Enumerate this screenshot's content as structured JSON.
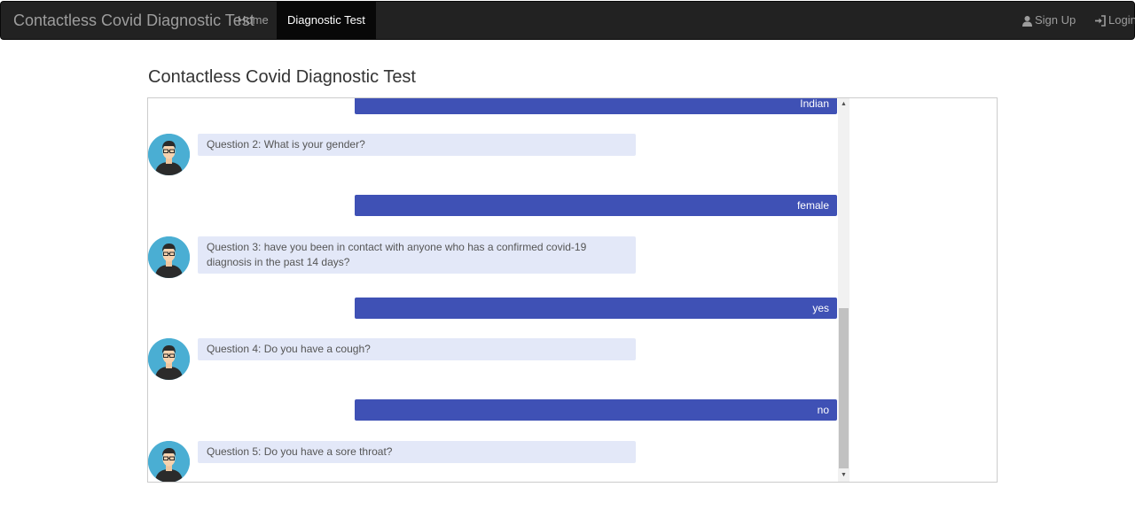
{
  "navbar": {
    "brand": "Contactless Covid Diagnostic Test",
    "links": [
      {
        "label": "Home",
        "active": false
      },
      {
        "label": "Diagnostic Test",
        "active": true
      }
    ],
    "right": [
      {
        "label": "Sign Up",
        "icon": "user-icon"
      },
      {
        "label": "Login",
        "icon": "login-icon"
      }
    ]
  },
  "page": {
    "title": "Contactless Covid Diagnostic Test"
  },
  "chat": {
    "messages": [
      {
        "sender": "user",
        "text": "Indian"
      },
      {
        "sender": "bot",
        "text": "Question 2: What is your gender?",
        "icon": "bot-avatar-icon"
      },
      {
        "sender": "user",
        "text": "female"
      },
      {
        "sender": "bot",
        "text": "Question 3: have you been in contact with anyone who has a confirmed covid-19 diagnosis in the past 14 days?",
        "icon": "bot-avatar-icon"
      },
      {
        "sender": "user",
        "text": "yes"
      },
      {
        "sender": "bot",
        "text": "Question 4: Do you have a cough?",
        "icon": "bot-avatar-icon"
      },
      {
        "sender": "user",
        "text": "no"
      },
      {
        "sender": "bot",
        "text": "Question 5: Do you have a sore throat?",
        "icon": "bot-avatar-icon"
      }
    ]
  },
  "colors": {
    "navbar_bg": "#222222",
    "user_bubble": "#3f51b5",
    "bot_bubble": "#e3e8f8",
    "avatar_bg": "#4aaed3"
  }
}
